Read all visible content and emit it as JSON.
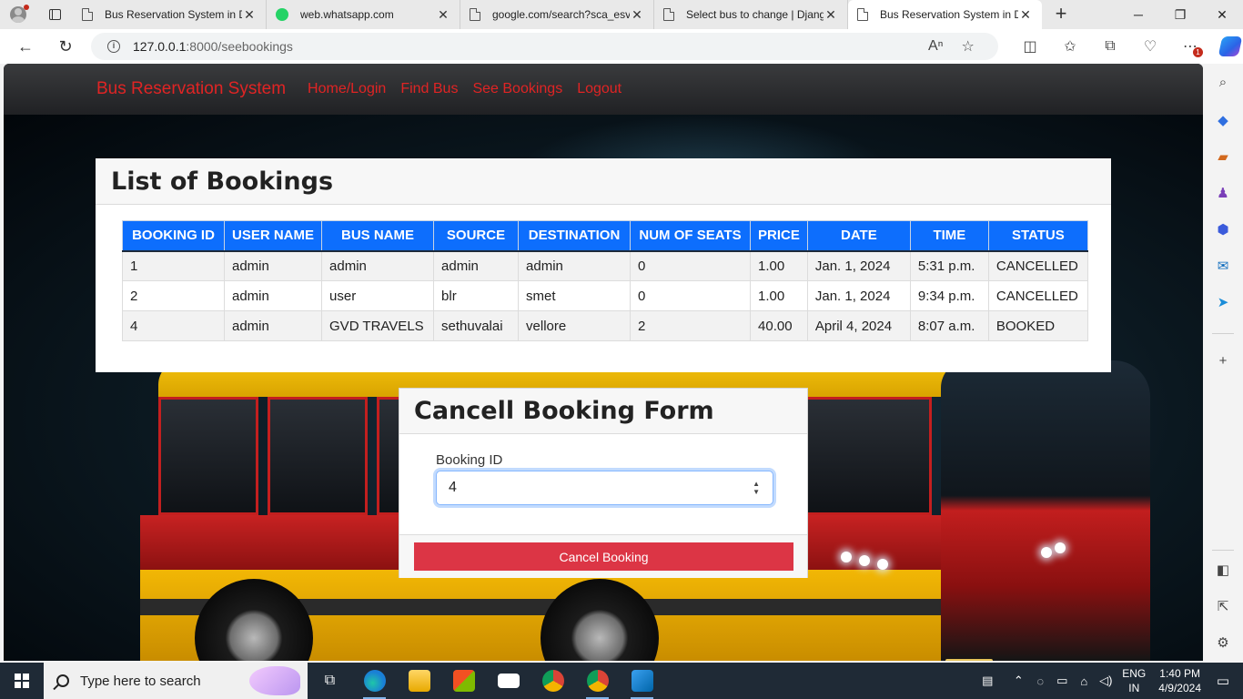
{
  "browser": {
    "tabs": [
      {
        "title": "Bus Reservation System in D",
        "icon": "page-icon",
        "active": false
      },
      {
        "title": "web.whatsapp.com",
        "icon": "whatsapp-icon",
        "active": false
      },
      {
        "title": "google.com/search?sca_esv",
        "icon": "page-icon",
        "active": false
      },
      {
        "title": "Select bus to change | Djang",
        "icon": "page-icon",
        "active": false
      },
      {
        "title": "Bus Reservation System in D",
        "icon": "page-icon",
        "active": true
      }
    ],
    "url_host": "127.0.0.1",
    "url_path": ":8000/seebookings",
    "notification_count": "1"
  },
  "navbar": {
    "brand": "Bus Reservation System",
    "links": [
      "Home/Login",
      "Find Bus",
      "See Bookings",
      "Logout"
    ]
  },
  "bookings": {
    "title": "List of Bookings",
    "columns": [
      "BOOKING ID",
      "USER NAME",
      "BUS NAME",
      "SOURCE",
      "DESTINATION",
      "NUM OF SEATS",
      "PRICE",
      "DATE",
      "TIME",
      "STATUS"
    ],
    "rows": [
      [
        "1",
        "admin",
        "admin",
        "admin",
        "admin",
        "0",
        "1.00",
        "Jan. 1, 2024",
        "5:31 p.m.",
        "CANCELLED"
      ],
      [
        "2",
        "admin",
        "user",
        "blr",
        "smet",
        "0",
        "1.00",
        "Jan. 1, 2024",
        "9:34 p.m.",
        "CANCELLED"
      ],
      [
        "4",
        "admin",
        "GVD TRAVELS",
        "sethuvalai",
        "vellore",
        "2",
        "40.00",
        "April 4, 2024",
        "8:07 a.m.",
        "BOOKED"
      ]
    ]
  },
  "cancel_form": {
    "title": "Cancell Booking Form",
    "label": "Booking ID",
    "value": "4",
    "button": "Cancel Booking"
  },
  "taskbar": {
    "search_placeholder": "Type here to search",
    "lang_top": "ENG",
    "lang_bottom": "IN",
    "time": "1:40 PM",
    "date": "4/9/2024"
  },
  "colors": {
    "brand_red": "#e02424",
    "table_header": "#0d6efd",
    "danger": "#dc3545"
  }
}
